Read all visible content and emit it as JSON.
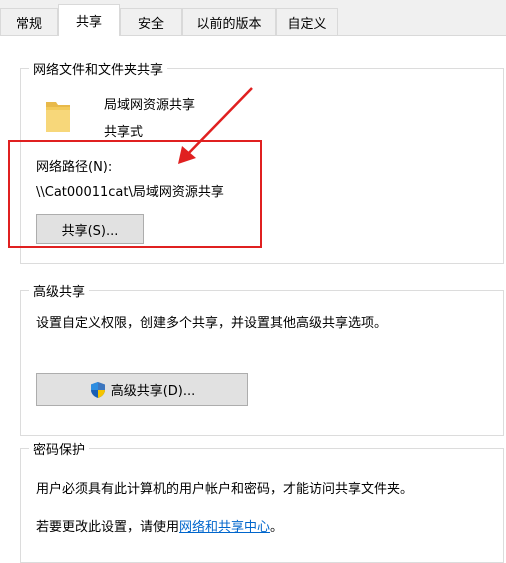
{
  "tabs": [
    "常规",
    "共享",
    "安全",
    "以前的版本",
    "自定义"
  ],
  "active_tab_index": 1,
  "network_share": {
    "group_title": "网络文件和文件夹共享",
    "folder_name": "局域网资源共享",
    "share_status": "共享式",
    "network_path_label": "网络路径(N):",
    "network_path": "\\\\Cat00011cat\\局域网资源共享",
    "share_button": "共享(S)..."
  },
  "advanced_sharing": {
    "group_title": "高级共享",
    "description": "设置自定义权限，创建多个共享，并设置其他高级共享选项。",
    "button": "高级共享(D)..."
  },
  "password_protection": {
    "group_title": "密码保护",
    "description": "用户必须具有此计算机的用户帐户和密码，才能访问共享文件夹。",
    "change_prefix": "若要更改此设置，请使用",
    "change_link": "网络和共享中心",
    "change_suffix": "。"
  },
  "annotation": {
    "color": "#e02020"
  }
}
